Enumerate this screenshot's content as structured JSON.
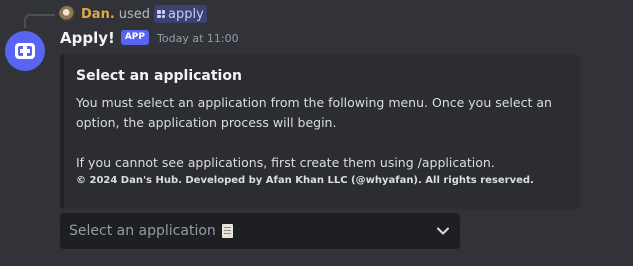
{
  "reply": {
    "user_name": "Dan.",
    "used_text": "used",
    "command_name": "apply"
  },
  "message": {
    "bot_name": "Apply!",
    "bot_tag": "APP",
    "timestamp": "Today at 11:00"
  },
  "embed": {
    "title": "Select an application",
    "description_line1": "You must select an application from the following menu. Once you select an option, the application process will begin.",
    "description_line2": "If you cannot see applications, first create them using /application.",
    "footer": "© 2024 Dan's Hub. Developed by Afan Khan LLC (@whyafan). All rights reserved."
  },
  "select_menu": {
    "placeholder": "Select an application"
  },
  "icons": {
    "command": "slash-command-icon",
    "scroll": "scroll-icon",
    "chevron": "chevron-down-icon"
  },
  "colors": {
    "background": "#313338",
    "embed_background": "#2b2d31",
    "select_background": "#1e1f22",
    "accent": "#5865f2",
    "reply_username": "#e0a84a"
  }
}
